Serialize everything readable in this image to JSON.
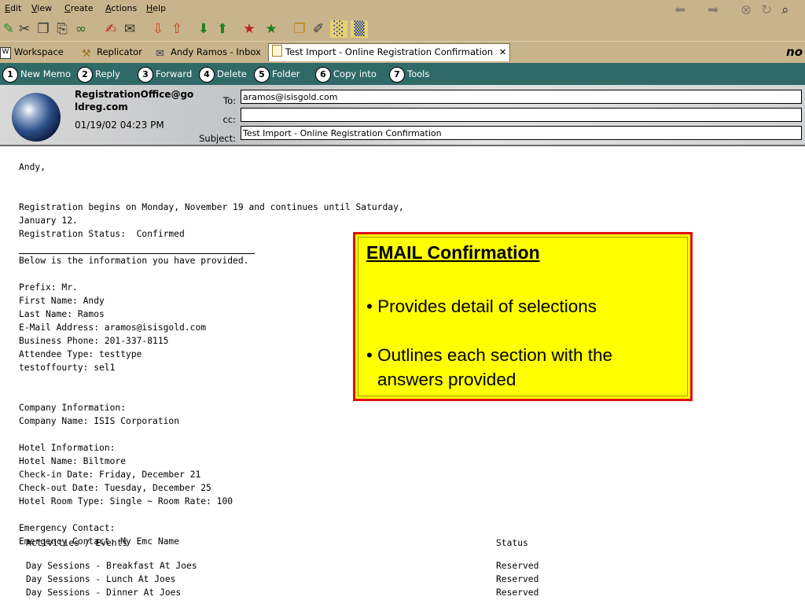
{
  "menu": {
    "items": [
      "Edit",
      "View",
      "Create",
      "Actions",
      "Help"
    ],
    "underline": [
      "E",
      "V",
      "C",
      "A",
      "H"
    ]
  },
  "nav_icons": [
    "back-icon",
    "forward-icon",
    "stop-icon",
    "refresh-icon",
    "search-icon"
  ],
  "toolbar_icons": [
    "edit-icon",
    "cut-icon",
    "copy-icon",
    "paste-icon",
    "link-icon",
    "pen-icon",
    "attach-icon",
    "download-icon",
    "upload-icon",
    "arrow-down-icon",
    "arrow-up-icon",
    "star-down-icon",
    "star-up-icon",
    "folder-icon",
    "tag-icon",
    "chart-icon",
    "calendar-icon"
  ],
  "tabs": [
    {
      "label": "Workspace",
      "icon": "workspace-icon",
      "active": false
    },
    {
      "label": "Replicator",
      "icon": "replicator-icon",
      "active": false
    },
    {
      "label": "Andy Ramos - Inbox",
      "icon": "inbox-icon",
      "active": false
    },
    {
      "label": "Test Import - Online Registration Confirmation",
      "icon": "document-icon",
      "active": true
    }
  ],
  "tab_close": "✕",
  "brand": "no",
  "actions": [
    {
      "num": "1",
      "label": "New Memo"
    },
    {
      "num": "2",
      "label": "Reply"
    },
    {
      "num": "3",
      "label": "Forward"
    },
    {
      "num": "4",
      "label": "Delete"
    },
    {
      "num": "5",
      "label": "Folder"
    },
    {
      "num": "6",
      "label": "Copy into"
    },
    {
      "num": "7",
      "label": "Tools"
    }
  ],
  "memo": {
    "from_line1": "RegistrationOffice@go",
    "from_line2": "ldreg.com",
    "date": "01/19/02 04:23 PM",
    "to_label": "To:",
    "cc_label": "cc:",
    "subject_label": "Subject:",
    "to": "aramos@isisgold.com",
    "cc": "",
    "subject": "Test Import - Online Registration Confirmation"
  },
  "body_lines": [
    "Andy,",
    "",
    "",
    "Registration begins on Monday, November 19 and continues until Saturday,",
    "January 12.",
    "Registration Status:  Confirmed",
    "",
    "Below is the information you have provided.",
    "",
    "Prefix: Mr.",
    "First Name: Andy",
    "Last Name: Ramos",
    "E-Mail Address: aramos@isisgold.com",
    "Business Phone: 201-337-8115",
    "Attendee Type: testtype",
    "testoffourty: sel1",
    "",
    "",
    "Company Information:",
    "Company Name: ISIS Corporation",
    "",
    "Hotel Information:",
    "Hotel Name: Biltmore",
    "Check-in Date: Friday, December 21",
    "Check-out Date: Tuesday, December 25",
    "Hotel Room Type: Single ~ Room Rate: 100",
    "",
    "Emergency Contact:",
    "Emergency Contact: My Emc Name"
  ],
  "activities": {
    "header_left": "Activities / Events",
    "header_right": "Status",
    "rows": [
      {
        "name": "Day Sessions - Breakfast At Joes",
        "status": "Reserved"
      },
      {
        "name": "Day Sessions - Lunch At Joes",
        "status": "Reserved"
      },
      {
        "name": "Day Sessions - Dinner At Joes",
        "status": "Reserved"
      }
    ]
  },
  "callout": {
    "title": "EMAIL Confirmation",
    "bullet1": "• Provides detail of selections",
    "bullet2a": "• Outlines each section with the",
    "bullet2b": "answers provided"
  },
  "colors": {
    "chrome": "#c8b48c",
    "action_bar": "#2f6a68",
    "callout_bg": "#ffff00",
    "callout_border": "#e01010"
  }
}
